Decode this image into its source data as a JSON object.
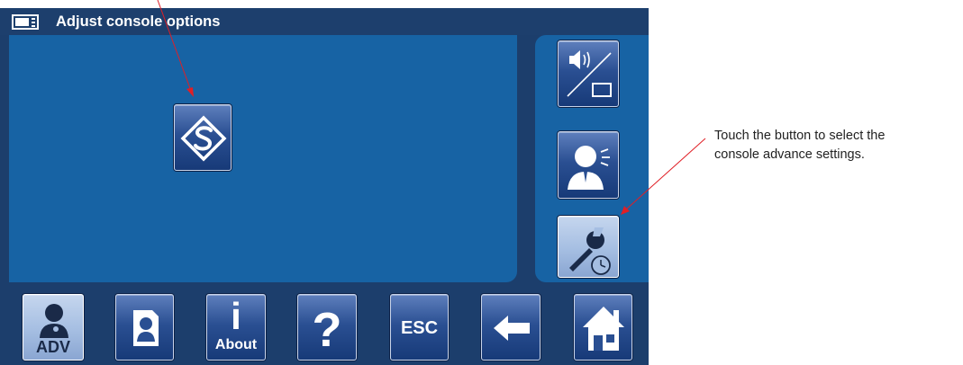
{
  "window": {
    "title": "Adjust console options",
    "title_icon": "monitor-icon"
  },
  "main_panel": {
    "buttons": [
      {
        "name": "service-settings-button",
        "icon": "diamond-s-logo-icon"
      }
    ]
  },
  "side_panel": {
    "buttons": [
      {
        "name": "audio-video-button",
        "icon": "speaker-monitor-icon"
      },
      {
        "name": "voice-settings-button",
        "icon": "speaking-person-icon"
      },
      {
        "name": "advanced-settings-button",
        "icon": "wrench-clock-icon",
        "selected": true
      }
    ]
  },
  "bottom_bar": {
    "adv_label": "ADV",
    "about_label": "About",
    "esc_label": "ESC",
    "help_glyph": "?",
    "about_glyph": "i",
    "buttons": [
      {
        "name": "adv-button",
        "icon": "person-icon",
        "selected": true
      },
      {
        "name": "contact-card-button",
        "icon": "contact-card-icon"
      },
      {
        "name": "about-button",
        "icon": "info-icon"
      },
      {
        "name": "help-button",
        "icon": "question-mark-icon"
      },
      {
        "name": "esc-button",
        "icon": "esc-icon"
      },
      {
        "name": "back-button",
        "icon": "arrow-left-icon"
      },
      {
        "name": "home-button",
        "icon": "home-icon"
      }
    ]
  },
  "annotation": {
    "line1": "Touch the button to select the",
    "line2": "console advance settings.",
    "arrow_color": "#e01f26"
  },
  "colors": {
    "screen_dark": "#1c3e6c",
    "panel_blue": "#1763a4",
    "button_blue": "#2a4f92",
    "button_selected": "#a5bee2"
  }
}
